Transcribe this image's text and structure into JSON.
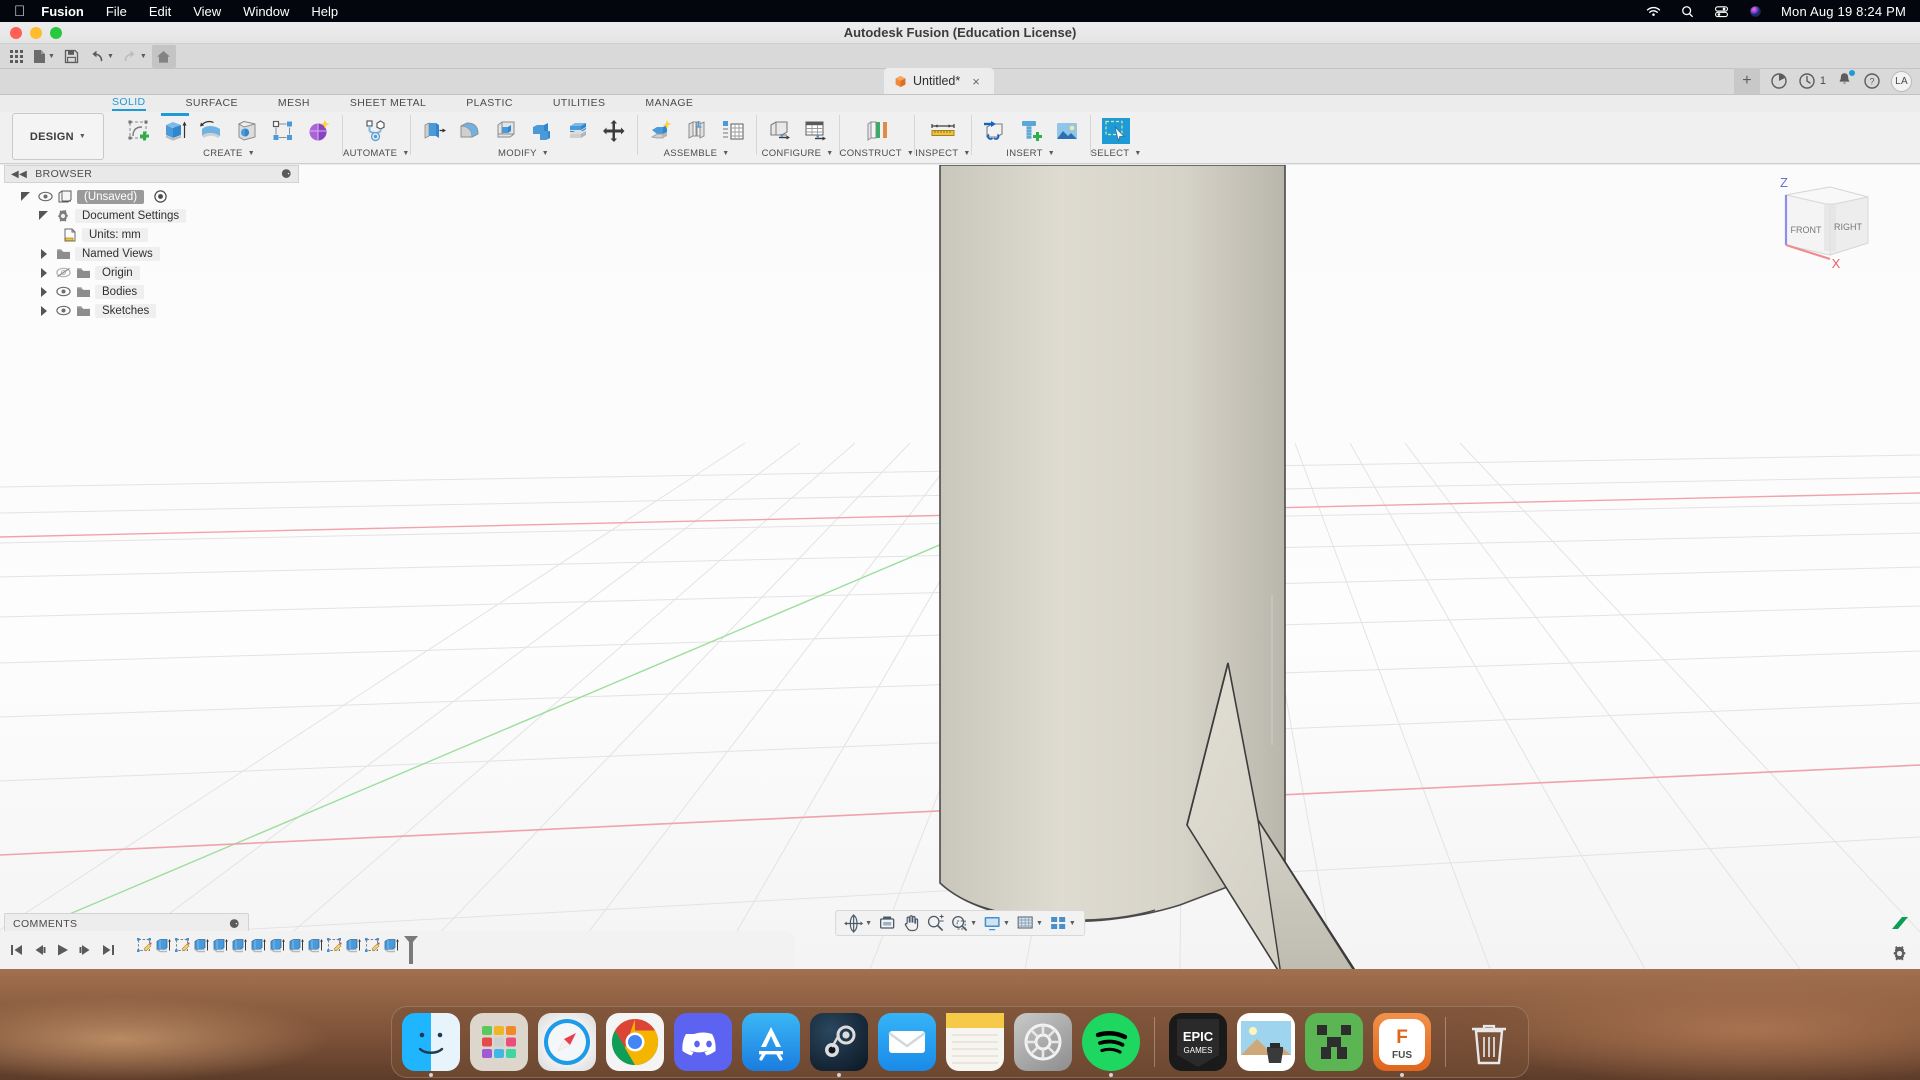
{
  "menubar": {
    "apple_icon": "apple-logo-icon",
    "items": [
      {
        "label": "Fusion",
        "bold": true
      },
      {
        "label": "File",
        "bold": false
      },
      {
        "label": "Edit",
        "bold": false
      },
      {
        "label": "View",
        "bold": false
      },
      {
        "label": "Window",
        "bold": false
      },
      {
        "label": "Help",
        "bold": false
      }
    ],
    "status_icons": [
      "wifi-icon",
      "search-icon",
      "control-center-icon",
      "siri-icon"
    ],
    "clock": "Mon Aug 19  8:24 PM"
  },
  "window": {
    "title": "Autodesk Fusion (Education License)",
    "traffic_lights": [
      "close-button",
      "minimize-button",
      "maximize-button"
    ]
  },
  "quick_access": {
    "buttons": [
      {
        "name": "show-data-panel-button",
        "icon": "grid-icon",
        "caret": false
      },
      {
        "name": "file-menu-button",
        "icon": "file-icon",
        "caret": true
      },
      {
        "name": "save-button",
        "icon": "save-icon",
        "caret": false
      },
      {
        "name": "undo-button",
        "icon": "undo-icon",
        "caret": true
      },
      {
        "name": "redo-button",
        "icon": "redo-icon",
        "caret": true
      },
      {
        "name": "home-button",
        "icon": "home-icon",
        "caret": false,
        "active": true
      }
    ]
  },
  "tabs": {
    "document": {
      "label": "Untitled*",
      "icon": "orange-cube-icon",
      "close": "×"
    },
    "new_tab": "+",
    "right_icons": [
      {
        "name": "job-status-icon",
        "glyph": "globe-icon"
      },
      {
        "name": "recent-activity-icon",
        "glyph": "clock-icon",
        "count": "1"
      },
      {
        "name": "notifications-icon",
        "glyph": "bell-icon",
        "dot": true
      },
      {
        "name": "help-icon",
        "glyph": "question-icon"
      }
    ],
    "avatar": "LA"
  },
  "ribbon": {
    "workspace": "DESIGN",
    "tabs": [
      {
        "label": "SOLID",
        "active": true
      },
      {
        "label": "SURFACE",
        "active": false
      },
      {
        "label": "MESH",
        "active": false
      },
      {
        "label": "SHEET METAL",
        "active": false
      },
      {
        "label": "PLASTIC",
        "active": false
      },
      {
        "label": "UTILITIES",
        "active": false
      },
      {
        "label": "MANAGE",
        "active": false
      }
    ],
    "groups": [
      {
        "label": "CREATE",
        "dropdown": true,
        "tools": [
          "create-sketch-icon",
          "extrude-icon",
          "revolve-icon",
          "hole-icon",
          "rectangular-pattern-icon",
          "create-form-icon"
        ]
      },
      {
        "label": "AUTOMATE",
        "dropdown": true,
        "tools": [
          "automate-icon"
        ]
      },
      {
        "label": "MODIFY",
        "dropdown": true,
        "tools": [
          "press-pull-icon",
          "fillet-icon",
          "shell-icon",
          "combine-icon",
          "offset-face-icon",
          "move-copy-icon"
        ]
      },
      {
        "label": "ASSEMBLE",
        "dropdown": true,
        "tools": [
          "new-component-icon",
          "joint-icon",
          "bill-of-materials-icon"
        ]
      },
      {
        "label": "CONFIGURE",
        "dropdown": true,
        "tools": [
          "configure-model-icon",
          "configure-table-icon"
        ]
      },
      {
        "label": "CONSTRUCT",
        "dropdown": true,
        "tools": [
          "offset-plane-icon"
        ]
      },
      {
        "label": "INSPECT",
        "dropdown": true,
        "tools": [
          "measure-icon"
        ]
      },
      {
        "label": "INSERT",
        "dropdown": true,
        "tools": [
          "insert-derive-icon",
          "insert-mcmaster-icon",
          "canvas-icon"
        ]
      },
      {
        "label": "SELECT",
        "dropdown": true,
        "tools": [
          "select-icon"
        ],
        "selected": true
      }
    ]
  },
  "browser": {
    "title": "BROWSER",
    "collapse_icon": "collapse-left-icon",
    "panel_icon": "minus-circle-icon",
    "nodes": [
      {
        "label": "(Unsaved)",
        "depth": 0,
        "twisty": "down",
        "eye": "visible",
        "icon": "document-icon",
        "selected": true,
        "target": true
      },
      {
        "label": "Document Settings",
        "depth": 1,
        "twisty": "down",
        "eye": "none",
        "icon": "gear-icon",
        "selected": false,
        "target": false
      },
      {
        "label": "Units: mm",
        "depth": 2,
        "twisty": "none",
        "eye": "none",
        "icon": "units-icon",
        "selected": false,
        "target": false
      },
      {
        "label": "Named Views",
        "depth": 1,
        "twisty": "right",
        "eye": "none",
        "icon": "folder-icon",
        "selected": false,
        "target": false
      },
      {
        "label": "Origin",
        "depth": 1,
        "twisty": "right",
        "eye": "hidden",
        "icon": "folder-icon",
        "selected": false,
        "target": false
      },
      {
        "label": "Bodies",
        "depth": 1,
        "twisty": "right",
        "eye": "visible",
        "icon": "folder-icon",
        "selected": false,
        "target": false
      },
      {
        "label": "Sketches",
        "depth": 1,
        "twisty": "right",
        "eye": "visible",
        "icon": "folder-icon",
        "selected": false,
        "target": false
      }
    ]
  },
  "comments": {
    "title": "COMMENTS",
    "panel_icon": "plus-circle-icon"
  },
  "viewcube": {
    "front_face": "FRONT",
    "right_face": "RIGHT",
    "axis_z": "Z",
    "axis_x": "X"
  },
  "navbar": {
    "buttons": [
      {
        "name": "orbit-button",
        "icon": "orbit-icon",
        "caret": true
      },
      {
        "name": "look-at-button",
        "icon": "look-at-icon",
        "caret": false
      },
      {
        "name": "pan-button",
        "icon": "pan-hand-icon",
        "caret": false
      },
      {
        "name": "zoom-button",
        "icon": "zoom-icon",
        "caret": false
      },
      {
        "name": "zoom-window-button",
        "icon": "zoom-window-icon",
        "caret": true
      },
      {
        "name": "display-settings-button",
        "icon": "monitor-icon",
        "caret": true
      },
      {
        "name": "grid-snaps-button",
        "icon": "grid-icon",
        "caret": true
      },
      {
        "name": "viewports-button",
        "icon": "viewport-layout-icon",
        "caret": true
      }
    ]
  },
  "timeline": {
    "playback": [
      "go-to-beginning-icon",
      "step-back-icon",
      "play-icon",
      "step-forward-icon",
      "go-to-end-icon"
    ],
    "features": [
      {
        "type": "sketch"
      },
      {
        "type": "extrude"
      },
      {
        "type": "sketch"
      },
      {
        "type": "extrude"
      },
      {
        "type": "extrude"
      },
      {
        "type": "extrude"
      },
      {
        "type": "extrude"
      },
      {
        "type": "extrude"
      },
      {
        "type": "extrude"
      },
      {
        "type": "extrude"
      },
      {
        "type": "sketch"
      },
      {
        "type": "extrude"
      },
      {
        "type": "sketch"
      },
      {
        "type": "extrude"
      }
    ],
    "end_marker": "timeline-marker-icon",
    "settings": "settings-gear-icon"
  },
  "dock": {
    "items": [
      {
        "name": "finder",
        "running": true
      },
      {
        "name": "launchpad",
        "running": false
      },
      {
        "name": "safari",
        "running": true
      },
      {
        "name": "chrome",
        "running": false
      },
      {
        "name": "discord",
        "running": false
      },
      {
        "name": "app-store",
        "running": false
      },
      {
        "name": "steam",
        "running": true
      },
      {
        "name": "mail",
        "running": false
      },
      {
        "name": "notes",
        "running": false
      },
      {
        "name": "system-settings",
        "running": false
      },
      {
        "name": "spotify",
        "running": true
      },
      {
        "name": "epic-games",
        "running": false
      },
      {
        "name": "preview",
        "running": false
      },
      {
        "name": "minecraft",
        "running": false
      },
      {
        "name": "fusion",
        "running": true
      },
      {
        "name": "trash",
        "running": false
      }
    ]
  },
  "colors": {
    "accent": "#1e9bd7",
    "model_fill": "#d8d5cb",
    "axis_x": "#e85d6a",
    "axis_y": "#5fc45f",
    "dock_bg": "#785037"
  }
}
